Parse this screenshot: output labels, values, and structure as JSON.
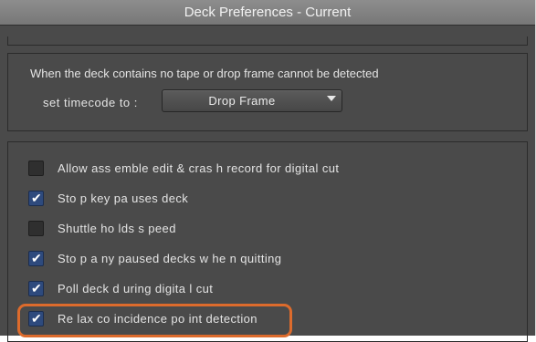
{
  "window": {
    "title": "Deck Preferences - Current"
  },
  "timecode": {
    "description": "When the deck contains no tape or drop frame cannot be detected",
    "label": "set timecode to :",
    "selected": "Drop Frame"
  },
  "options": [
    {
      "label": "Allow ass emble edit & cras h record for digital cut",
      "checked": false
    },
    {
      "label": "Sto p key pa uses deck",
      "checked": true
    },
    {
      "label": "Shuttle ho lds s peed",
      "checked": false
    },
    {
      "label": "Sto p a ny paused decks w he n quitting",
      "checked": true
    },
    {
      "label": "Poll deck d uring digita l cut",
      "checked": true
    },
    {
      "label": "Re lax co incidence po int detection",
      "checked": true
    }
  ],
  "highlight_color": "#dd6b2c",
  "accent_color": "#2e4a7d"
}
